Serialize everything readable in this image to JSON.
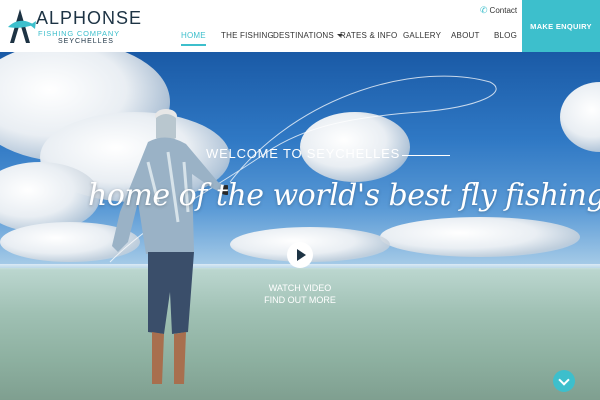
{
  "brand": {
    "name": "ALPHONSE",
    "line1": "FISHING COMPANY",
    "line2": "SEYCHELLES"
  },
  "contact": {
    "icon": "phone-icon",
    "label": "Contact"
  },
  "nav": {
    "items": [
      {
        "label": "HOME",
        "active": true
      },
      {
        "label": "THE FISHING"
      },
      {
        "label": "DESTINATIONS",
        "has_dropdown": true
      },
      {
        "label": "RATES & INFO"
      },
      {
        "label": "GALLERY"
      },
      {
        "label": "ABOUT"
      },
      {
        "label": "BLOG"
      }
    ],
    "cta": "MAKE ENQUIRY"
  },
  "hero": {
    "welcome": "WELCOME TO SEYCHELLES",
    "tagline": "home of the world's best fly fishing.",
    "watch_video": "WATCH VIDEO",
    "find_out_more": "FIND OUT MORE"
  },
  "colors": {
    "accent": "#3dbfcc",
    "navy": "#1d3344"
  }
}
